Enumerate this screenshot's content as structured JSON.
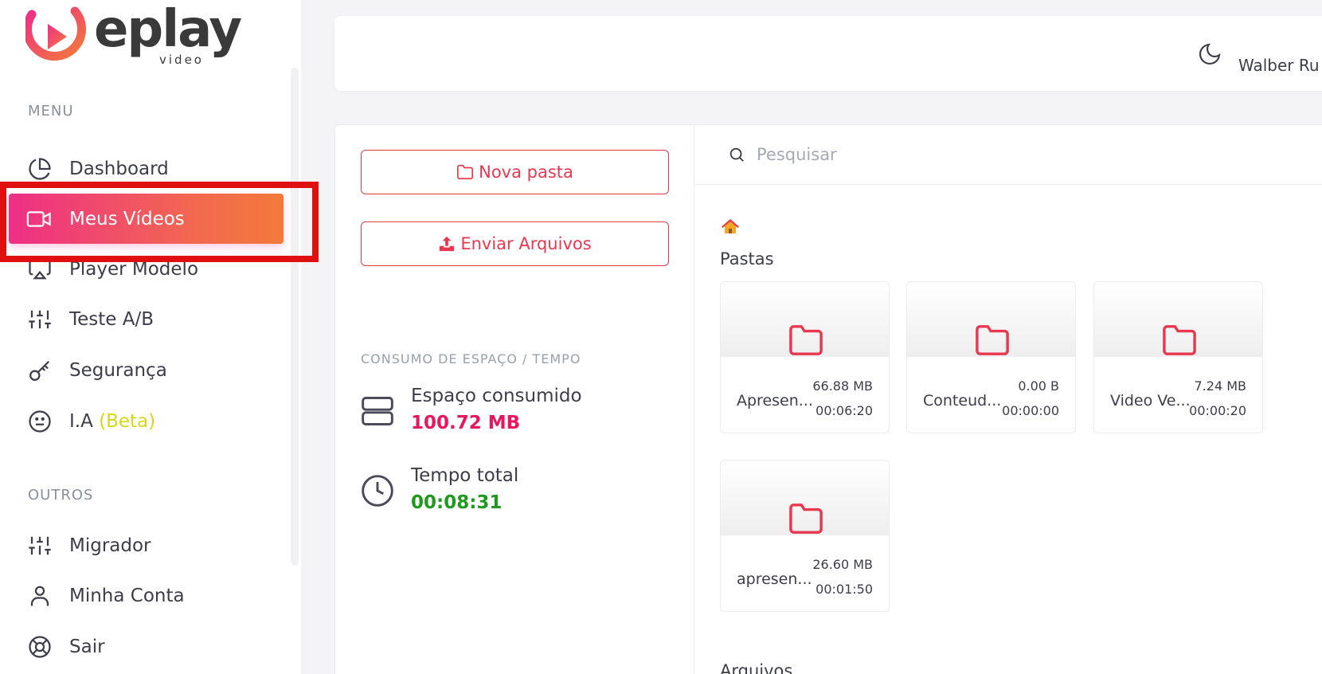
{
  "brand": {
    "name": "eplay",
    "sub": "video",
    "accent": "#ee2f86",
    "accent2": "#f27a3a"
  },
  "sidebar": {
    "menu_label": "MENU",
    "others_label": "OUTROS",
    "items": [
      {
        "label": "Dashboard",
        "icon": "pie-chart-icon"
      },
      {
        "label": "Meus Vídeos",
        "icon": "video-camera-icon",
        "active": true
      },
      {
        "label": "Player Modelo",
        "icon": "airplay-icon"
      },
      {
        "label": "Teste A/B",
        "icon": "sliders-icon"
      },
      {
        "label": "Segurança",
        "icon": "key-icon"
      },
      {
        "label": "I.A ",
        "suffix": "(Beta)",
        "icon": "meh-face-icon"
      }
    ],
    "others": [
      {
        "label": "Migrador",
        "icon": "sliders-icon"
      },
      {
        "label": "Minha Conta",
        "icon": "user-icon"
      },
      {
        "label": "Sair",
        "icon": "life-buoy-icon"
      }
    ]
  },
  "header": {
    "username": "Walber Ru",
    "theme_icon": "moon-icon"
  },
  "actions": {
    "new_folder": "Nova pasta",
    "upload": "Enviar Arquivos"
  },
  "usage": {
    "label": "CONSUMO DE ESPAÇO / TEMPO",
    "space_title": "Espaço consumido",
    "space_value": "100.72 MB",
    "space_color": "#e8175d",
    "time_title": "Tempo total",
    "time_value": "00:08:31",
    "time_color": "#1f9a1f"
  },
  "search": {
    "placeholder": "Pesquisar",
    "value": ""
  },
  "folders": {
    "title": "Pastas",
    "items": [
      {
        "name": "Apresen...",
        "size": "66.88 MB",
        "duration": "00:06:20"
      },
      {
        "name": "Conteud...",
        "size": "0.00 B",
        "duration": "00:00:00"
      },
      {
        "name": "Video Ve...",
        "size": "7.24 MB",
        "duration": "00:00:20"
      },
      {
        "name": "apresen...",
        "size": "26.60 MB",
        "duration": "00:01:50"
      }
    ]
  },
  "files": {
    "title": "Arquivos"
  }
}
